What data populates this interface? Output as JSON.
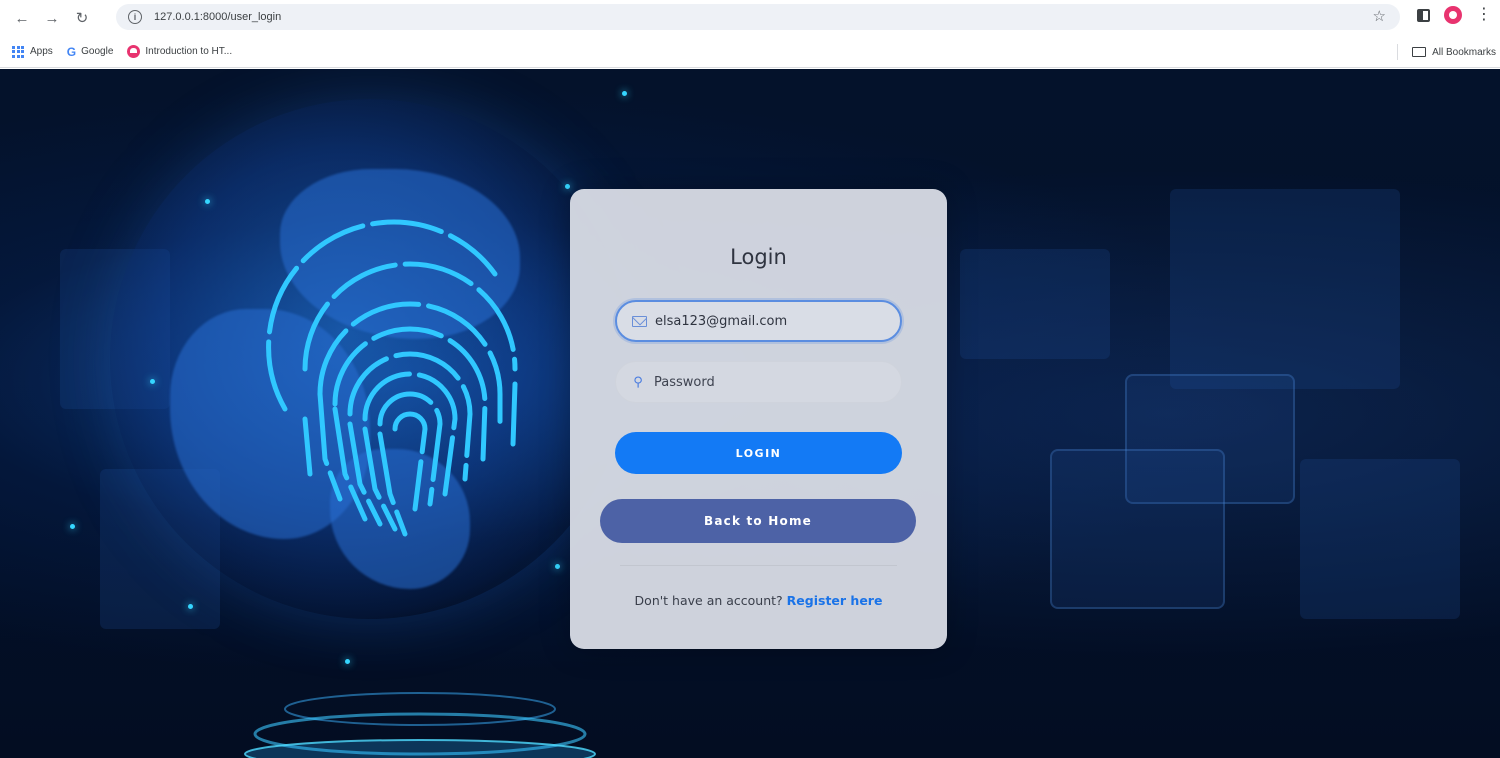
{
  "browser": {
    "url": "127.0.0.1:8000/user_login",
    "bookmarks": [
      {
        "label": "Apps"
      },
      {
        "label": "Google"
      },
      {
        "label": "Introduction to HT..."
      }
    ],
    "all_bookmarks_label": "All Bookmarks",
    "icons": [
      "back-arrow-icon",
      "forward-arrow-icon",
      "reload-icon",
      "site-info-icon",
      "star-icon",
      "side-panel-icon",
      "profile-icon",
      "menu-icon",
      "folder-icon"
    ]
  },
  "login": {
    "title": "Login",
    "email_value": "elsa123@gmail.com",
    "password_placeholder": "Password",
    "login_button": "LOGIN",
    "home_button": "Back to Home",
    "signup_prompt": "Don't have an account?",
    "signup_link": "Register here"
  },
  "colors": {
    "primary": "#137af5",
    "secondary": "#4d62a6",
    "card": "#d5d9e2",
    "link": "#1a73e8",
    "background": "#021029"
  }
}
